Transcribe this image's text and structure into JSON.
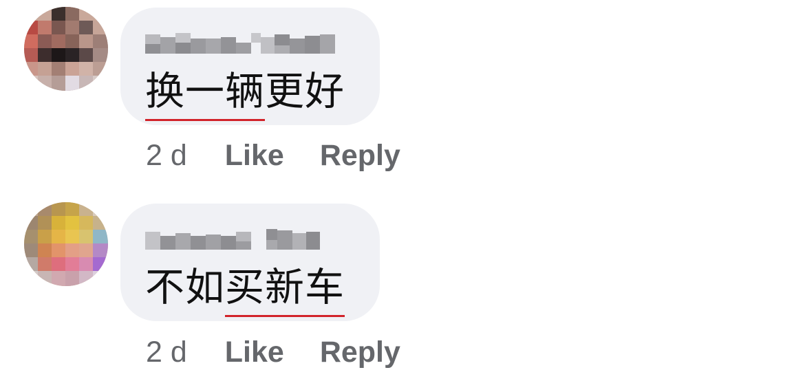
{
  "comments": [
    {
      "text_pre": "",
      "text_underlined": "换一辆",
      "text_post": "更好",
      "time": "2 d",
      "like_label": "Like",
      "reply_label": "Reply",
      "spellcheck_color": "#d2232a"
    },
    {
      "text_pre": "不如",
      "text_underlined": "买新车",
      "text_post": "",
      "time": "2 d",
      "like_label": "Like",
      "reply_label": "Reply",
      "spellcheck_color": "#d2232a"
    }
  ],
  "colors": {
    "bubble_bg": "#f0f1f5",
    "meta_text": "#65676b",
    "comment_text": "#111111"
  }
}
